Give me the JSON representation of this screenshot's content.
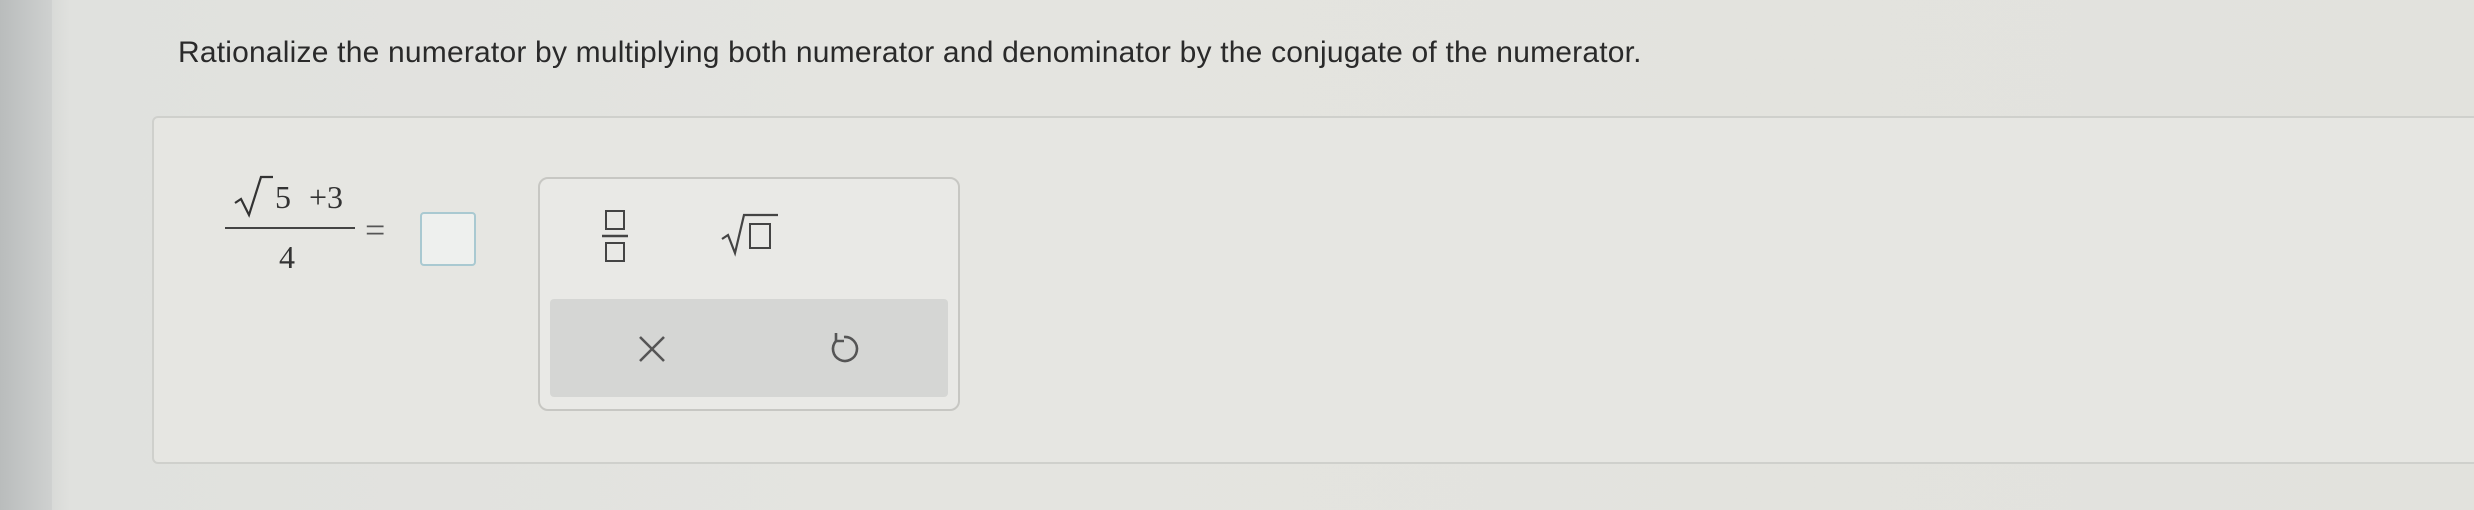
{
  "question": {
    "text": "Rationalize the numerator by multiplying both numerator and denominator by the conjugate of the numerator."
  },
  "expression": {
    "radicand": "5",
    "numerator_rest": "+3",
    "denominator": "4",
    "equals": "="
  },
  "answer_box": {
    "value": ""
  },
  "keypad": {
    "keys": [
      {
        "icon": "fraction-icon"
      },
      {
        "icon": "square-root-icon"
      },
      {
        "icon": "close-icon"
      },
      {
        "icon": "undo-icon"
      }
    ]
  },
  "colors": {
    "text": "#2a2a2a",
    "answer_box_border": "#a9c9d1",
    "keypad_footer": "#d5d6d4"
  }
}
